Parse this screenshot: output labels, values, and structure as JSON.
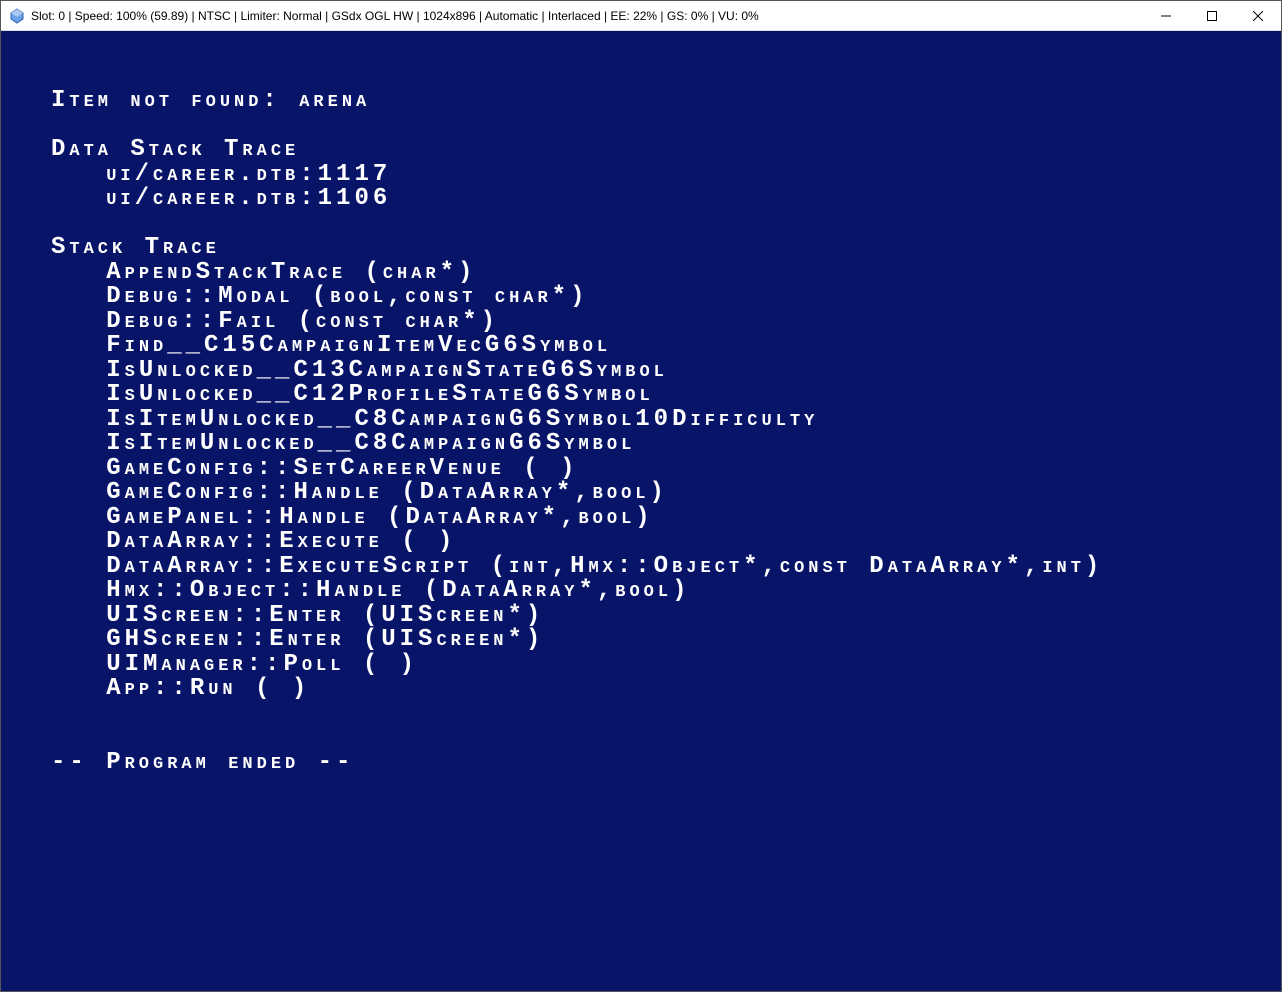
{
  "title": "Slot: 0 | Speed: 100% (59.89) | NTSC | Limiter: Normal | GSdx OGL HW | 1024x896 | Automatic | Interlaced | EE:  22% | GS:   0% | VU:   0%",
  "error": {
    "header": "Item not found: arena",
    "data_stack_label": "Data Stack Trace",
    "data_stack": [
      "ui/career.dtb:1117",
      "ui/career.dtb:1106"
    ],
    "stack_label": "Stack Trace",
    "stack": [
      "AppendStackTrace (char*)",
      "Debug::Modal (bool,const char*)",
      "Debug::Fail (const char*)",
      "Find__C15CampaignItemVecG6Symbol",
      "IsUnlocked__C13CampaignStateG6Symbol",
      "IsUnlocked__C12ProfileStateG6Symbol",
      "IsItemUnlocked__C8CampaignG6Symbol10Difficulty",
      "IsItemUnlocked__C8CampaignG6Symbol",
      "GameConfig::SetCareerVenue ( )",
      "GameConfig::Handle (DataArray*,bool)",
      "GamePanel::Handle (DataArray*,bool)",
      "DataArray::Execute ( )",
      "DataArray::ExecuteScript (int,Hmx::Object*,const DataArray*,int)",
      "Hmx::Object::Handle (DataArray*,bool)",
      "UIScreen::Enter (UIScreen*)",
      "GHScreen::Enter (UIScreen*)",
      "UIManager::Poll ( )",
      "App::Run ( )"
    ],
    "footer": "-- Program ended --"
  }
}
